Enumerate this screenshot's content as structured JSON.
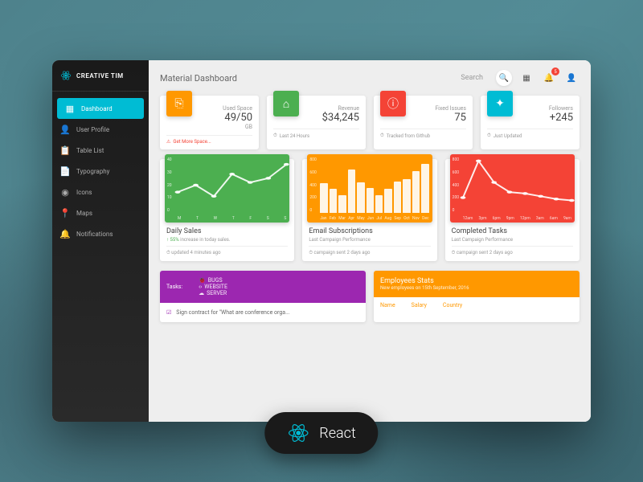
{
  "brand": "CREATIVE TIM",
  "page_title": "Material Dashboard",
  "search_placeholder": "Search",
  "notification_count": "5",
  "sidebar": {
    "items": [
      {
        "label": "Dashboard",
        "icon": "▦"
      },
      {
        "label": "User Profile",
        "icon": "👤"
      },
      {
        "label": "Table List",
        "icon": "📋"
      },
      {
        "label": "Typography",
        "icon": "📄"
      },
      {
        "label": "Icons",
        "icon": "◉"
      },
      {
        "label": "Maps",
        "icon": "📍"
      },
      {
        "label": "Notifications",
        "icon": "🔔"
      }
    ]
  },
  "stats": [
    {
      "label": "Used Space",
      "value": "49/50",
      "unit": "GB",
      "footer": "Get More Space...",
      "color": "#ff9800",
      "icon": "⎘",
      "warn": true
    },
    {
      "label": "Revenue",
      "value": "$34,245",
      "unit": "",
      "footer": "Last 24 Hours",
      "color": "#4caf50",
      "icon": "⌂"
    },
    {
      "label": "Fixed Issues",
      "value": "75",
      "unit": "",
      "footer": "Tracked from Github",
      "color": "#f44336",
      "icon": "ⓘ"
    },
    {
      "label": "Followers",
      "value": "+245",
      "unit": "",
      "footer": "Just Updated",
      "color": "#00bcd4",
      "icon": "✦"
    }
  ],
  "chart_data": [
    {
      "type": "line",
      "title": "Daily Sales",
      "sub_prefix": "55%",
      "sub": " increase in today sales.",
      "footer": "updated 4 minutes ago",
      "color": "#4caf50",
      "categories": [
        "M",
        "T",
        "W",
        "T",
        "F",
        "S",
        "S"
      ],
      "values": [
        15,
        20,
        12,
        28,
        22,
        25,
        35
      ],
      "ylabel": "",
      "ylim": [
        0,
        40
      ],
      "yticks": [
        40,
        30,
        20,
        10,
        0
      ]
    },
    {
      "type": "bar",
      "title": "Email Subscriptions",
      "sub": "Last Campaign Performance",
      "footer": "campaign sent 2 days ago",
      "color": "#ff9800",
      "categories": [
        "Jan",
        "Feb",
        "Mar",
        "Apr",
        "May",
        "Jun",
        "Jul",
        "Aug",
        "Sep",
        "Oct",
        "Nov",
        "Dec"
      ],
      "values": [
        540,
        440,
        320,
        780,
        550,
        450,
        320,
        430,
        560,
        610,
        750,
        890
      ],
      "ylim": [
        0,
        1000
      ],
      "yticks": [
        800,
        600,
        400,
        200,
        0
      ]
    },
    {
      "type": "line",
      "title": "Completed Tasks",
      "sub": "Last Campaign Performance",
      "footer": "campaign sent 2 days ago",
      "color": "#f44336",
      "categories": [
        "12am",
        "3pm",
        "6pm",
        "9pm",
        "12pm",
        "3am",
        "6am",
        "9am"
      ],
      "values": [
        220,
        750,
        440,
        300,
        280,
        240,
        200,
        180
      ],
      "ylim": [
        0,
        800
      ],
      "yticks": [
        800,
        600,
        400,
        200,
        0
      ]
    }
  ],
  "tasks": {
    "label": "Tasks:",
    "tabs": [
      {
        "label": "BUGS",
        "icon": "🐞"
      },
      {
        "label": "WEBSITE",
        "icon": "‹›"
      },
      {
        "label": "SERVER",
        "icon": "☁"
      }
    ],
    "row": "Sign contract for \"What are conference orga..."
  },
  "employees": {
    "title": "Employees Stats",
    "sub": "New employees on 15th September, 2016",
    "cols": [
      "Name",
      "Salary",
      "Country"
    ]
  },
  "pill": "React"
}
